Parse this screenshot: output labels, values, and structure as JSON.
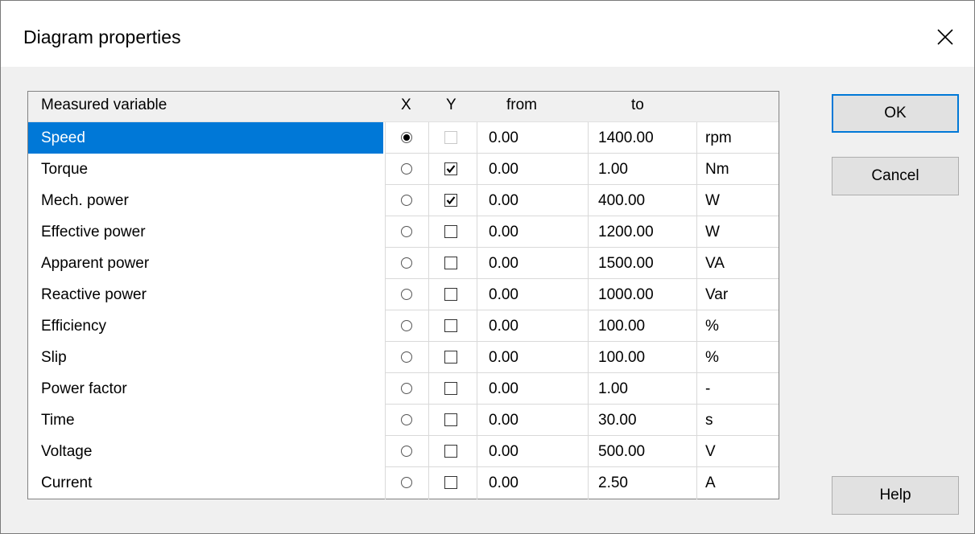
{
  "title": "Diagram properties",
  "columns": {
    "variable": "Measured variable",
    "x": "X",
    "y": "Y",
    "from": "from",
    "to": "to"
  },
  "rows": [
    {
      "name": "Speed",
      "x": true,
      "y": false,
      "y_enabled": false,
      "from": "0.00",
      "to": "1400.00",
      "unit": "rpm",
      "selected": true
    },
    {
      "name": "Torque",
      "x": false,
      "y": true,
      "y_enabled": true,
      "from": "0.00",
      "to": "1.00",
      "unit": "Nm",
      "selected": false
    },
    {
      "name": "Mech. power",
      "x": false,
      "y": true,
      "y_enabled": true,
      "from": "0.00",
      "to": "400.00",
      "unit": "W",
      "selected": false
    },
    {
      "name": "Effective power",
      "x": false,
      "y": false,
      "y_enabled": true,
      "from": "0.00",
      "to": "1200.00",
      "unit": "W",
      "selected": false
    },
    {
      "name": "Apparent power",
      "x": false,
      "y": false,
      "y_enabled": true,
      "from": "0.00",
      "to": "1500.00",
      "unit": "VA",
      "selected": false
    },
    {
      "name": "Reactive power",
      "x": false,
      "y": false,
      "y_enabled": true,
      "from": "0.00",
      "to": "1000.00",
      "unit": "Var",
      "selected": false
    },
    {
      "name": "Efficiency",
      "x": false,
      "y": false,
      "y_enabled": true,
      "from": "0.00",
      "to": "100.00",
      "unit": "%",
      "selected": false
    },
    {
      "name": "Slip",
      "x": false,
      "y": false,
      "y_enabled": true,
      "from": "0.00",
      "to": "100.00",
      "unit": "%",
      "selected": false
    },
    {
      "name": "Power factor",
      "x": false,
      "y": false,
      "y_enabled": true,
      "from": "0.00",
      "to": "1.00",
      "unit": "-",
      "selected": false
    },
    {
      "name": "Time",
      "x": false,
      "y": false,
      "y_enabled": true,
      "from": "0.00",
      "to": "30.00",
      "unit": "s",
      "selected": false
    },
    {
      "name": "Voltage",
      "x": false,
      "y": false,
      "y_enabled": true,
      "from": "0.00",
      "to": "500.00",
      "unit": "V",
      "selected": false
    },
    {
      "name": "Current",
      "x": false,
      "y": false,
      "y_enabled": true,
      "from": "0.00",
      "to": "2.50",
      "unit": "A",
      "selected": false
    }
  ],
  "buttons": {
    "ok": "OK",
    "cancel": "Cancel",
    "help": "Help"
  },
  "icons": {
    "close": "close-icon",
    "check": "checkmark-icon"
  },
  "colors": {
    "selection": "#0078d7",
    "default_button_border": "#0078d7"
  }
}
